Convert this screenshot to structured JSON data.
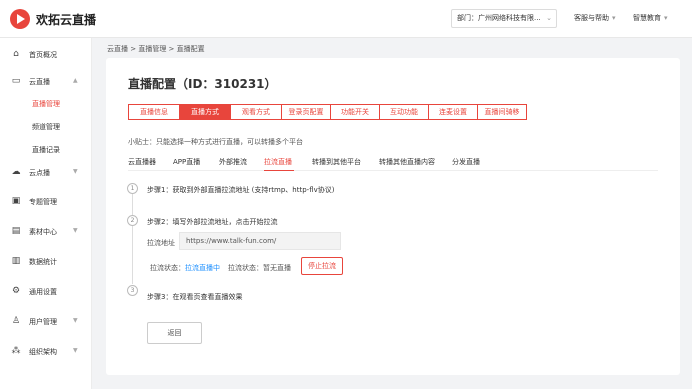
{
  "header": {
    "logo_text": "欢拓云直播",
    "department": "部门：广州网络科技有限...",
    "help_label": "客服与帮助",
    "edu_label": "智慧教育"
  },
  "sidebar": {
    "home": "首页概况",
    "live": "云直播",
    "live_sub": [
      "直播管理",
      "频道管理",
      "直播记录"
    ],
    "vod": "云点播",
    "topic": "专题管理",
    "material": "素材中心",
    "stats": "数据统计",
    "settings": "通用设置",
    "users": "用户管理",
    "org": "组织架构"
  },
  "breadcrumb": "云直播 > 直播管理 > 直播配置",
  "page": {
    "title": "直播配置（ID：310231）",
    "tabs": [
      "直播信息",
      "直播方式",
      "观看方式",
      "登录页配置",
      "功能开关",
      "互动功能",
      "连麦设置",
      "直播间骑移"
    ],
    "tip": "小贴士：只能选择一种方式进行直播，可以转播多个平台",
    "subtabs": [
      "云直播器",
      "APP直播",
      "外部推流",
      "拉流直播",
      "转播到其他平台",
      "转播其他直播内容",
      "分发直播"
    ],
    "step_numbers": [
      "1",
      "2",
      "3"
    ],
    "step1": "步骤1：获取到外部直播拉流地址 (支持rtmp、http-flv协议)",
    "step2": "步骤2：填写外部拉流地址，点击开始拉流",
    "url_label": "拉流地址",
    "url_value": "https://www.talk-fun.com/",
    "status1_label": "拉流状态：",
    "status1_value": "拉流直播中",
    "status2_label": "拉流状态：",
    "status2_value": "暂无直播",
    "stop_button": "停止拉流",
    "step3": "步骤3：在观看页查看直播效果",
    "back_button": "返回"
  },
  "colors": {
    "accent": "#e8453c",
    "link": "#1e90ff"
  }
}
